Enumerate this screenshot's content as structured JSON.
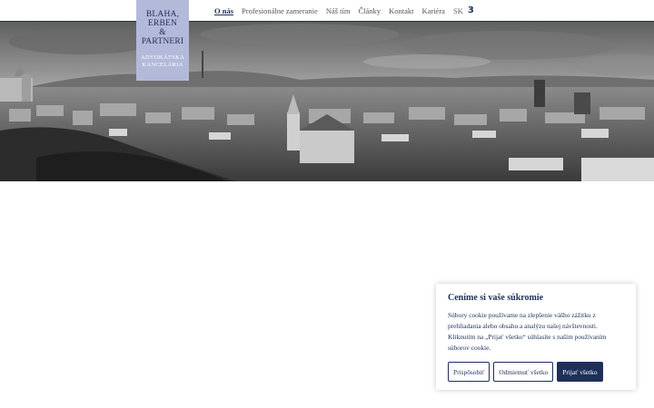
{
  "logo": {
    "line1": "BLAHA,",
    "line2": "ERBEN",
    "line3": "&",
    "line4": "PARTNERI",
    "sub1": "ADVOKÁTSKA",
    "sub2": "KANCELÁRIA"
  },
  "nav": {
    "items": [
      {
        "label": "O nás"
      },
      {
        "label": "Profesionálne zameranie"
      },
      {
        "label": "Náš tím"
      },
      {
        "label": "Články"
      },
      {
        "label": "Kontakt"
      },
      {
        "label": "Kariéra"
      }
    ],
    "lang": "SK",
    "menu_glyph": "3"
  },
  "colors": {
    "brand": "#1e2f59",
    "logo_bg": "#b3b9d9"
  },
  "cookie": {
    "title": "Ceníme si vaše súkromie",
    "text": "Súbory cookie používame na zlepšenie vášho zážitku z prehliadania alebo obsahu a analýzu našej návštevnosti. Kliknutím na „Prijať všetko“ súhlasíte s naším používaním súborov cookie.",
    "customize_label": "Prispôsobiť",
    "reject_label": "Odmietnuť všetko",
    "accept_label": "Prijať všetko"
  }
}
